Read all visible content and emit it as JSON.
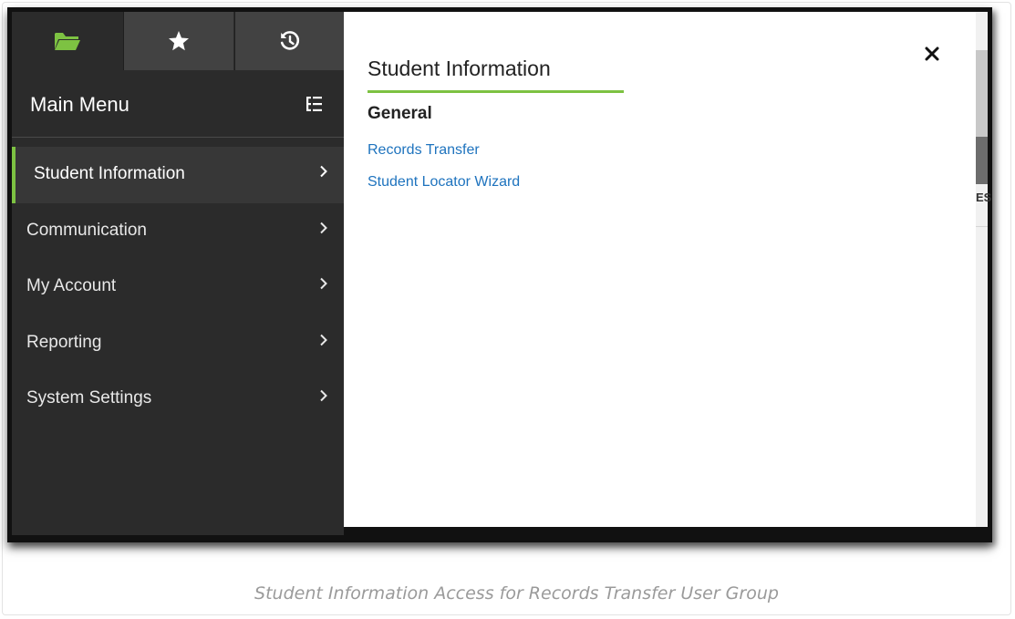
{
  "tabs": [
    {
      "name": "all-tools",
      "icon": "folder-open-icon",
      "active": true
    },
    {
      "name": "favorites",
      "icon": "star-icon",
      "active": false
    },
    {
      "name": "history",
      "icon": "history-icon",
      "active": false
    }
  ],
  "menu": {
    "title": "Main Menu",
    "items": [
      {
        "label": "Student Information",
        "active": true
      },
      {
        "label": "Communication",
        "active": false
      },
      {
        "label": "My Account",
        "active": false
      },
      {
        "label": "Reporting",
        "active": false
      },
      {
        "label": "System Settings",
        "active": false
      }
    ]
  },
  "panel": {
    "title": "Student Information",
    "section": "General",
    "links": [
      "Records Transfer",
      "Student Locator Wizard"
    ]
  },
  "background": {
    "partial_text": "ES"
  },
  "caption": "Student Information Access for Records Transfer User  Group",
  "colors": {
    "accent": "#7dc242",
    "link": "#1e73be",
    "menu_bg": "#2b2b2b",
    "tab_bg": "#424242"
  }
}
